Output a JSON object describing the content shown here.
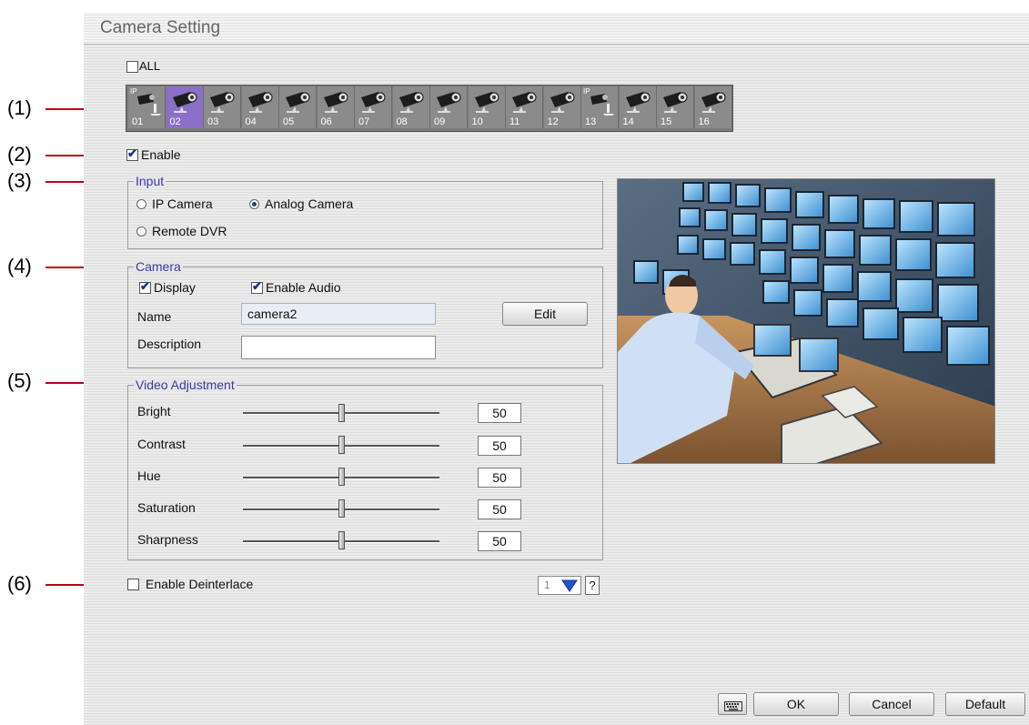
{
  "window": {
    "title": "Camera Setting"
  },
  "callouts": [
    "(1)",
    "(2)",
    "(3)",
    "(4)",
    "(5)",
    "(6)"
  ],
  "all_label": "ALL",
  "all_checked": false,
  "cameras": [
    {
      "num": "01",
      "type": "IP",
      "ip_label": "IP",
      "selected": false
    },
    {
      "num": "02",
      "type": "analog",
      "selected": true
    },
    {
      "num": "03",
      "type": "analog",
      "selected": false
    },
    {
      "num": "04",
      "type": "analog",
      "selected": false
    },
    {
      "num": "05",
      "type": "analog",
      "selected": false
    },
    {
      "num": "06",
      "type": "analog",
      "selected": false
    },
    {
      "num": "07",
      "type": "analog",
      "selected": false
    },
    {
      "num": "08",
      "type": "analog",
      "selected": false
    },
    {
      "num": "09",
      "type": "analog",
      "selected": false
    },
    {
      "num": "10",
      "type": "analog",
      "selected": false
    },
    {
      "num": "11",
      "type": "analog",
      "selected": false
    },
    {
      "num": "12",
      "type": "analog",
      "selected": false
    },
    {
      "num": "13",
      "type": "IP",
      "ip_label": "IP",
      "selected": false
    },
    {
      "num": "14",
      "type": "analog",
      "selected": false
    },
    {
      "num": "15",
      "type": "analog",
      "selected": false
    },
    {
      "num": "16",
      "type": "analog",
      "selected": false
    }
  ],
  "enable": {
    "label": "Enable",
    "checked": true
  },
  "input": {
    "legend": "Input",
    "ip_camera": "IP Camera",
    "analog_camera": "Analog Camera",
    "remote_dvr": "Remote DVR",
    "selected": "Analog Camera"
  },
  "camera": {
    "legend": "Camera",
    "display_label": "Display",
    "display_checked": true,
    "audio_label": "Enable Audio",
    "audio_checked": true,
    "name_label": "Name",
    "name_value": "camera2",
    "description_label": "Description",
    "description_value": "",
    "edit_label": "Edit"
  },
  "video": {
    "legend": "Video Adjustment",
    "rows": [
      {
        "label": "Bright",
        "value": "50"
      },
      {
        "label": "Contrast",
        "value": "50"
      },
      {
        "label": "Hue",
        "value": "50"
      },
      {
        "label": "Saturation",
        "value": "50"
      },
      {
        "label": "Sharpness",
        "value": "50"
      }
    ]
  },
  "deinterlace": {
    "label": "Enable Deinterlace",
    "checked": false,
    "select_value": "1",
    "help": "?"
  },
  "footer": {
    "ok": "OK",
    "cancel": "Cancel",
    "default": "Default"
  },
  "colors": {
    "accent": "#8c6fc9",
    "callout": "#c0001a",
    "legend": "#3a3aa8"
  }
}
